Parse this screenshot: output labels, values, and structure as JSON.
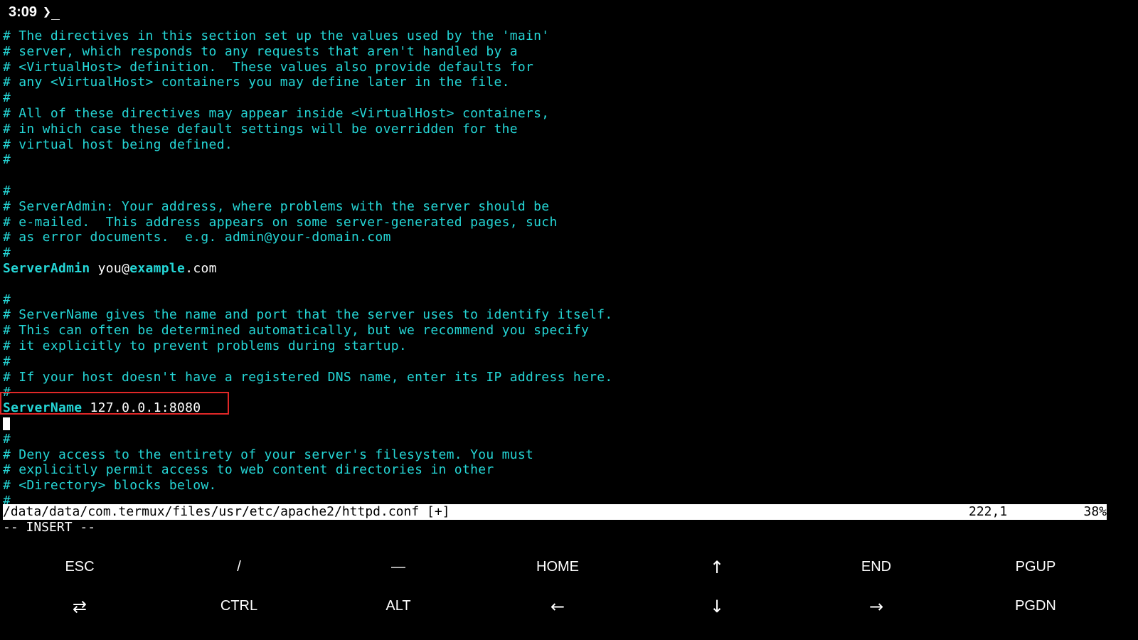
{
  "statusbar": {
    "time": "3:09",
    "app_icon": "terminal-prompt-icon",
    "app_icon_glyph": "❯_"
  },
  "editor": {
    "lines": [
      "# The directives in this section set up the values used by the 'main'",
      "# server, which responds to any requests that aren't handled by a",
      "# <VirtualHost> definition.  These values also provide defaults for",
      "# any <VirtualHost> containers you may define later in the file.",
      "#",
      "# All of these directives may appear inside <VirtualHost> containers,",
      "# in which case these default settings will be overridden for the",
      "# virtual host being defined.",
      "#",
      "",
      "#",
      "# ServerAdmin: Your address, where problems with the server should be",
      "# e-mailed.  This address appears on some server-generated pages, such",
      "# as error documents.  e.g. admin@your-domain.com",
      "#"
    ],
    "server_admin": {
      "keyword": "ServerAdmin",
      "value_user": "you@",
      "value_domain": "example",
      "value_tld": ".com"
    },
    "lines2": [
      "",
      "#",
      "# ServerName gives the name and port that the server uses to identify itself.",
      "# This can often be determined automatically, but we recommend you specify",
      "# it explicitly to prevent problems during startup.",
      "#",
      "# If your host doesn't have a registered DNS name, enter its IP address here.",
      "#"
    ],
    "server_name": {
      "keyword": "ServerName",
      "value": "127.0.0.1:8080"
    },
    "lines3": [
      "#",
      "# Deny access to the entirety of your server's filesystem. You must",
      "# explicitly permit access to web content directories in other",
      "# <Directory> blocks below.",
      "#"
    ]
  },
  "modeline": {
    "path": "/data/data/com.termux/files/usr/etc/apache2/httpd.conf [+]",
    "position": "222,1",
    "percent": "38%"
  },
  "mode": "-- INSERT --",
  "extra_keys": {
    "row1": [
      "ESC",
      "/",
      "—",
      "HOME",
      "↑",
      "END",
      "PGUP"
    ],
    "row2": [
      "⇄",
      "CTRL",
      "ALT",
      "←",
      "↓",
      "→",
      "PGDN"
    ]
  },
  "colors": {
    "comment": "#25d6d6",
    "value": "#ffffff",
    "highlight_border": "#e02828",
    "background": "#000000"
  }
}
